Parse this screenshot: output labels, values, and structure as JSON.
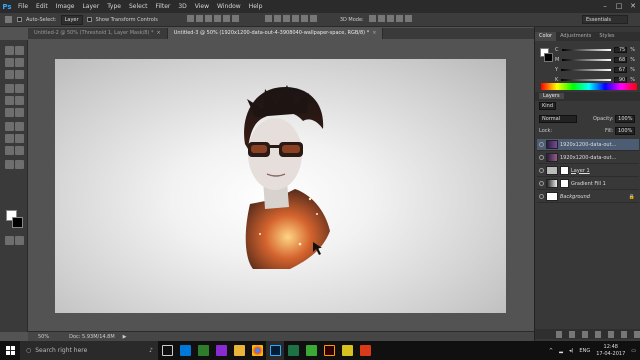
{
  "menubar": {
    "logo": "Ps",
    "items": [
      "File",
      "Edit",
      "Image",
      "Layer",
      "Type",
      "Select",
      "Filter",
      "3D",
      "View",
      "Window",
      "Help"
    ],
    "window_controls": [
      "–",
      "□",
      "✕"
    ]
  },
  "options": {
    "auto_select_label": "Auto-Select:",
    "auto_select_target": "Layer",
    "transform_label": "Show Transform Controls",
    "mode_label": "3D Mode:",
    "workspace": "Essentials"
  },
  "tabs": [
    {
      "label": "Untitled-2 @ 50% (Threshold 1, Layer Mask/8) *",
      "close": "×"
    },
    {
      "label": "Untitled-3 @ 50% (1920x1200-data-out-4-3908040-wallpaper-space, RGB/8) *",
      "close": "×"
    }
  ],
  "statusbar": {
    "zoom": "50%",
    "doc_info": "Doc: 5.93M/14.8M"
  },
  "color_panel": {
    "tabs": [
      "Color",
      "Adjustments",
      "Styles"
    ],
    "channels": [
      {
        "name": "C",
        "value": "75",
        "unit": "%"
      },
      {
        "name": "M",
        "value": "68",
        "unit": "%"
      },
      {
        "name": "Y",
        "value": "67",
        "unit": "%"
      },
      {
        "name": "K",
        "value": "90",
        "unit": "%"
      }
    ]
  },
  "layers_panel": {
    "title": "Layers",
    "filter_label": "Kind",
    "blend_mode": "Normal",
    "opacity_label": "Opacity:",
    "opacity_value": "100%",
    "lock_label": "Lock:",
    "fill_label": "Fill:",
    "fill_value": "100%",
    "layers": [
      {
        "name": "1920x1200-data-out..."
      },
      {
        "name": "1920x1200-data-out..."
      },
      {
        "name": "Layer 1"
      },
      {
        "name": "Gradient Fill 1"
      },
      {
        "name": "Background"
      }
    ]
  },
  "taskbar": {
    "search_placeholder": "Search right here",
    "lang": "ENG",
    "time": "12:48",
    "date": "17-04-2017"
  },
  "colors": {
    "fg": "#ffffff",
    "bg": "#000000",
    "selection": "#4c5c72",
    "ps_blue": "#31a8ff"
  }
}
